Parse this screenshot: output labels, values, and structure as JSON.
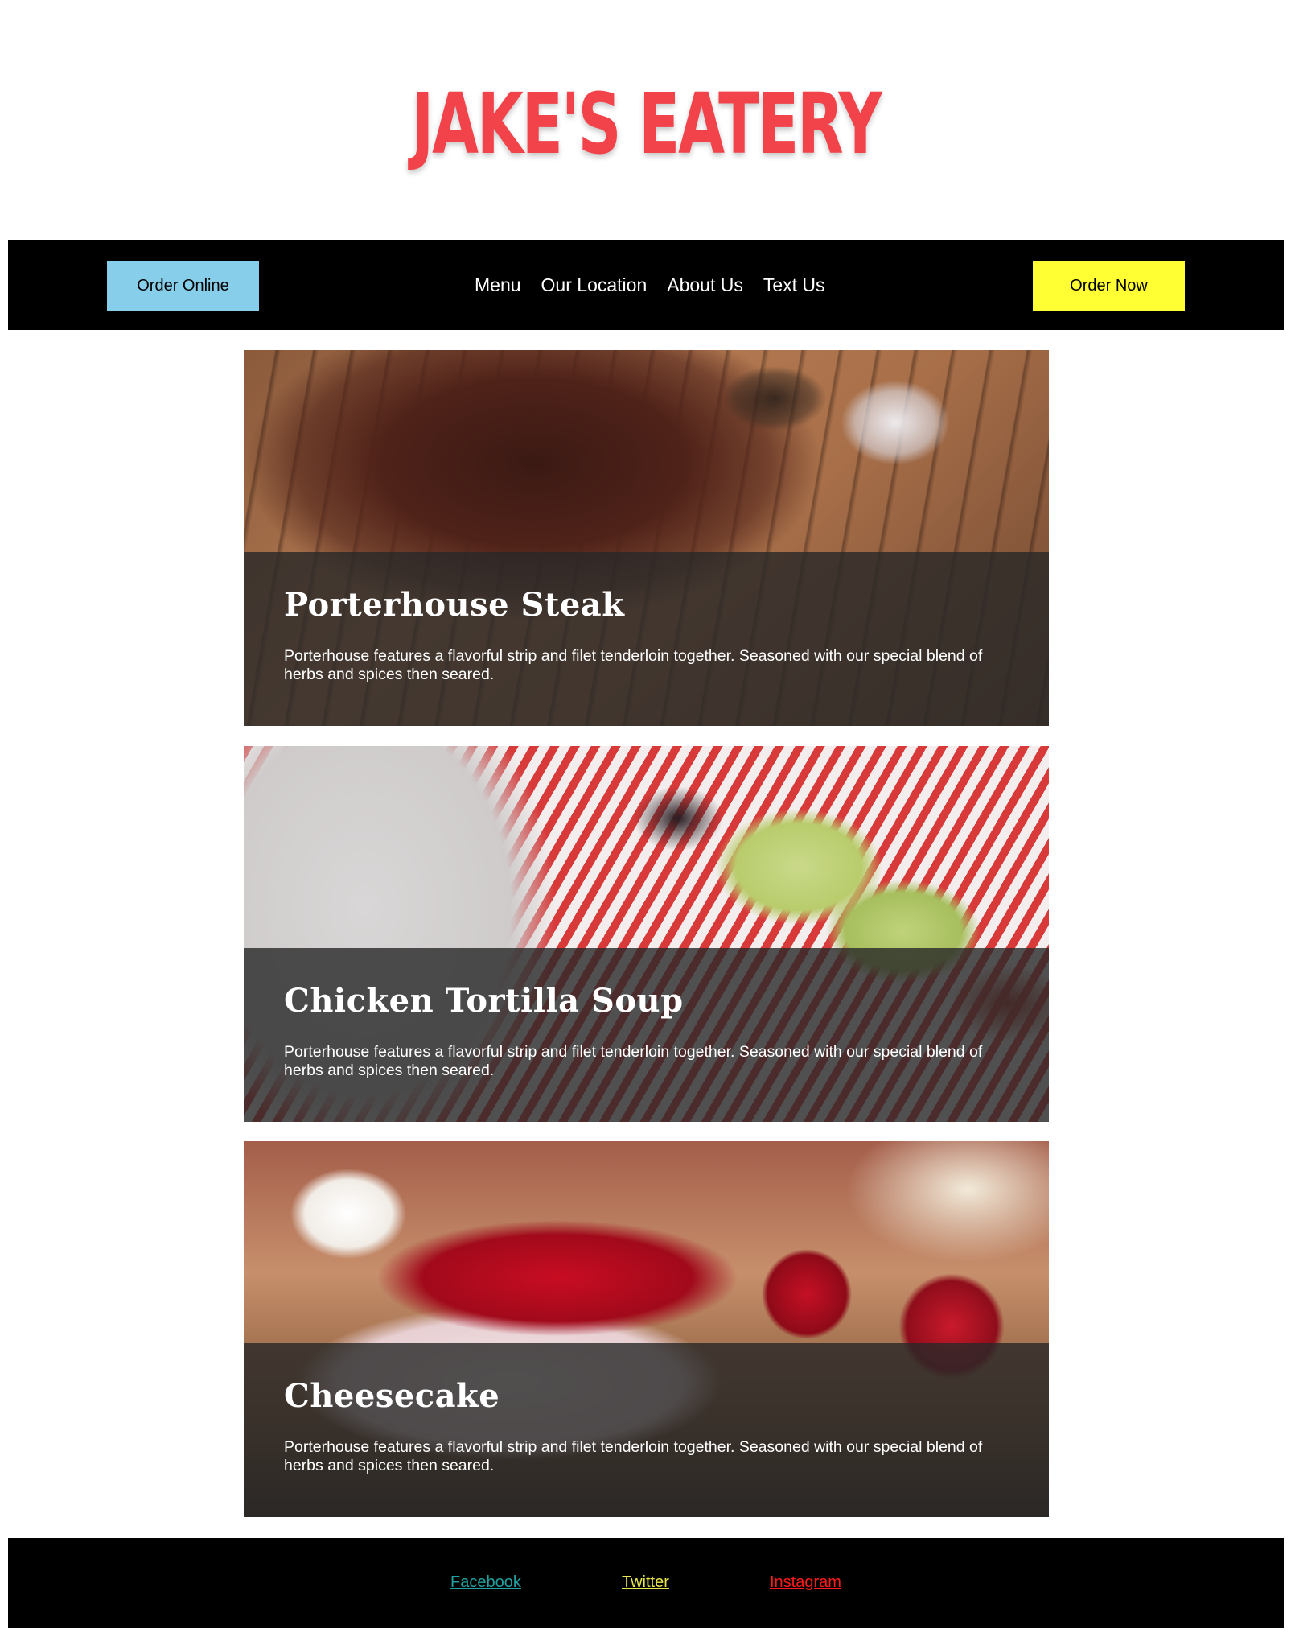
{
  "header": {
    "logo_text": "JAKE'S EATERY",
    "logo_color": "#f2434b"
  },
  "nav": {
    "order_online_label": "Order Online",
    "order_now_label": "Order Now",
    "links": [
      "Menu",
      "Our Location",
      "About Us",
      "Text Us"
    ],
    "order_online_color": "#87ceeb",
    "order_now_color": "#ffff33"
  },
  "cards": [
    {
      "title": "Porterhouse Steak",
      "description": "Porterhouse features a flavorful strip and filet tenderloin together. Seasoned with our special blend of herbs and spices then seared."
    },
    {
      "title": "Chicken Tortilla Soup",
      "description": "Porterhouse features a flavorful strip and filet tenderloin together. Seasoned with our special blend of herbs and spices then seared."
    },
    {
      "title": "Cheesecake",
      "description": "Porterhouse features a flavorful strip and filet tenderloin together. Seasoned with our special blend of herbs and spices then seared."
    }
  ],
  "footer": {
    "links": [
      {
        "label": "Facebook",
        "color": "#20a0a0"
      },
      {
        "label": "Twitter",
        "color": "#e6e64a"
      },
      {
        "label": "Instagram",
        "color": "#ff1a1a"
      }
    ]
  }
}
